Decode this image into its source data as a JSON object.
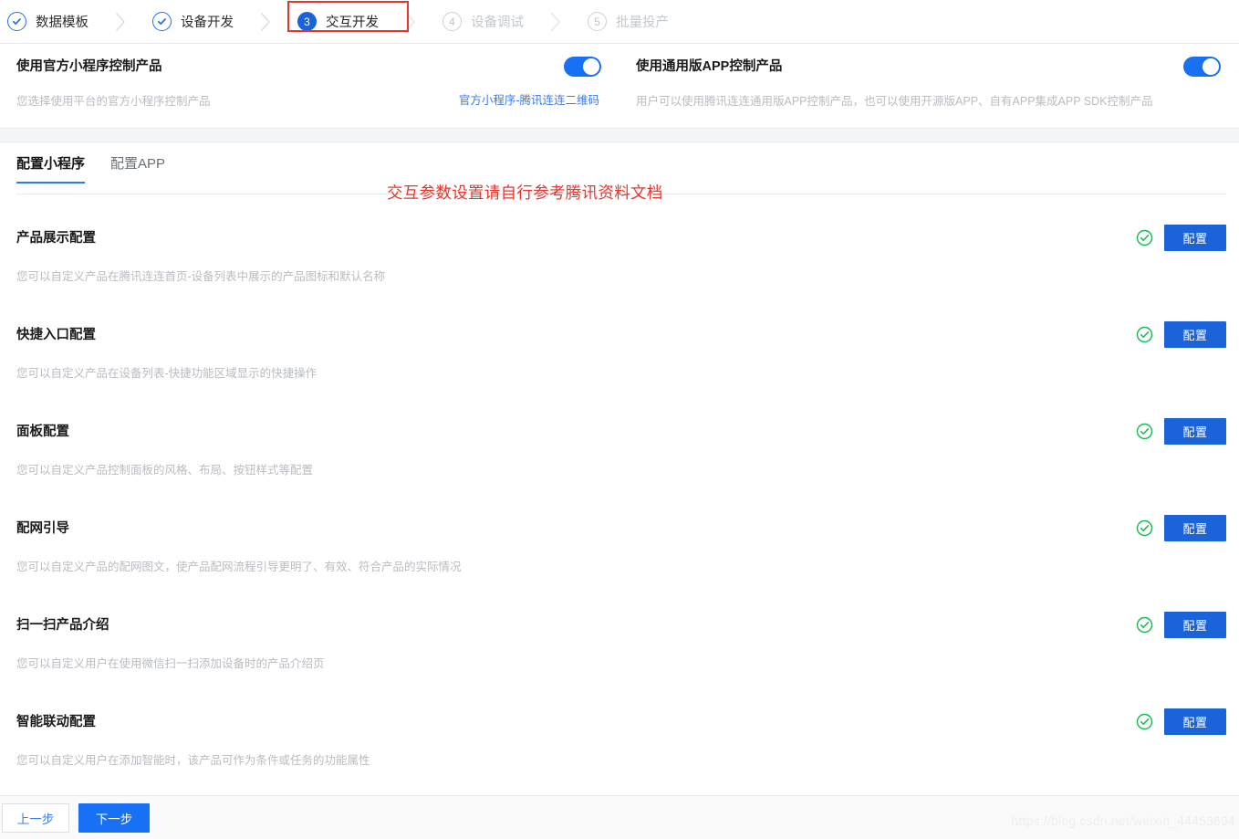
{
  "stepper": {
    "steps": [
      {
        "label": "数据模板",
        "state": "done",
        "number": "1",
        "icon": "check-icon"
      },
      {
        "label": "设备开发",
        "state": "done",
        "number": "2",
        "icon": "check-icon"
      },
      {
        "label": "交互开发",
        "state": "active",
        "number": "3",
        "icon": ""
      },
      {
        "label": "设备调试",
        "state": "pending",
        "number": "4",
        "icon": ""
      },
      {
        "label": "批量投产",
        "state": "pending",
        "number": "5",
        "icon": ""
      }
    ],
    "highlight_color": "#e8342c",
    "active_color": "#1a63d8"
  },
  "toggles": [
    {
      "title": "使用官方小程序控制产品",
      "description": "您选择使用平台的官方小程序控制产品",
      "link": "官方小程序-腾讯连连二维码",
      "enabled": true
    },
    {
      "title": "使用通用版APP控制产品",
      "description": "用户可以使用腾讯连连通用版APP控制产品，也可以使用开源版APP、自有APP集成APP SDK控制产品",
      "link": "",
      "enabled": true
    }
  ],
  "tabs": [
    {
      "label": "配置小程序",
      "active": true
    },
    {
      "label": "配置APP",
      "active": false
    }
  ],
  "annotation": "交互参数设置请自行参考腾讯资料文档",
  "config_rows": [
    {
      "title": "产品展示配置",
      "description": "您可以自定义产品在腾讯连连首页-设备列表中展示的产品图标和默认名称",
      "status": "complete",
      "button_label": "配置"
    },
    {
      "title": "快捷入口配置",
      "description": "您可以自定义产品在设备列表-快捷功能区域显示的快捷操作",
      "status": "complete",
      "button_label": "配置"
    },
    {
      "title": "面板配置",
      "description": "您可以自定义产品控制面板的风格、布局、按钮样式等配置",
      "status": "complete",
      "button_label": "配置"
    },
    {
      "title": "配网引导",
      "description": "您可以自定义产品的配网图文，使产品配网流程引导更明了、有效、符合产品的实际情况",
      "status": "complete",
      "button_label": "配置"
    },
    {
      "title": "扫一扫产品介绍",
      "description": "您可以自定义用户在使用微信扫一扫添加设备时的产品介绍页",
      "status": "complete",
      "button_label": "配置"
    },
    {
      "title": "智能联动配置",
      "description": "您可以自定义用户在添加智能时，该产品可作为条件或任务的功能属性",
      "status": "complete",
      "button_label": "配置"
    }
  ],
  "footer": {
    "prev_label": "上一步",
    "next_label": "下一步"
  },
  "watermark": "https://blog.csdn.net/weixin_44453694",
  "colors": {
    "primary": "#1870f5",
    "button_blue": "#1a63d8",
    "link_blue": "#3c7ce8",
    "success_green": "#19b955",
    "annotation_red": "#e8342c",
    "muted_text": "#b8bcc2"
  }
}
